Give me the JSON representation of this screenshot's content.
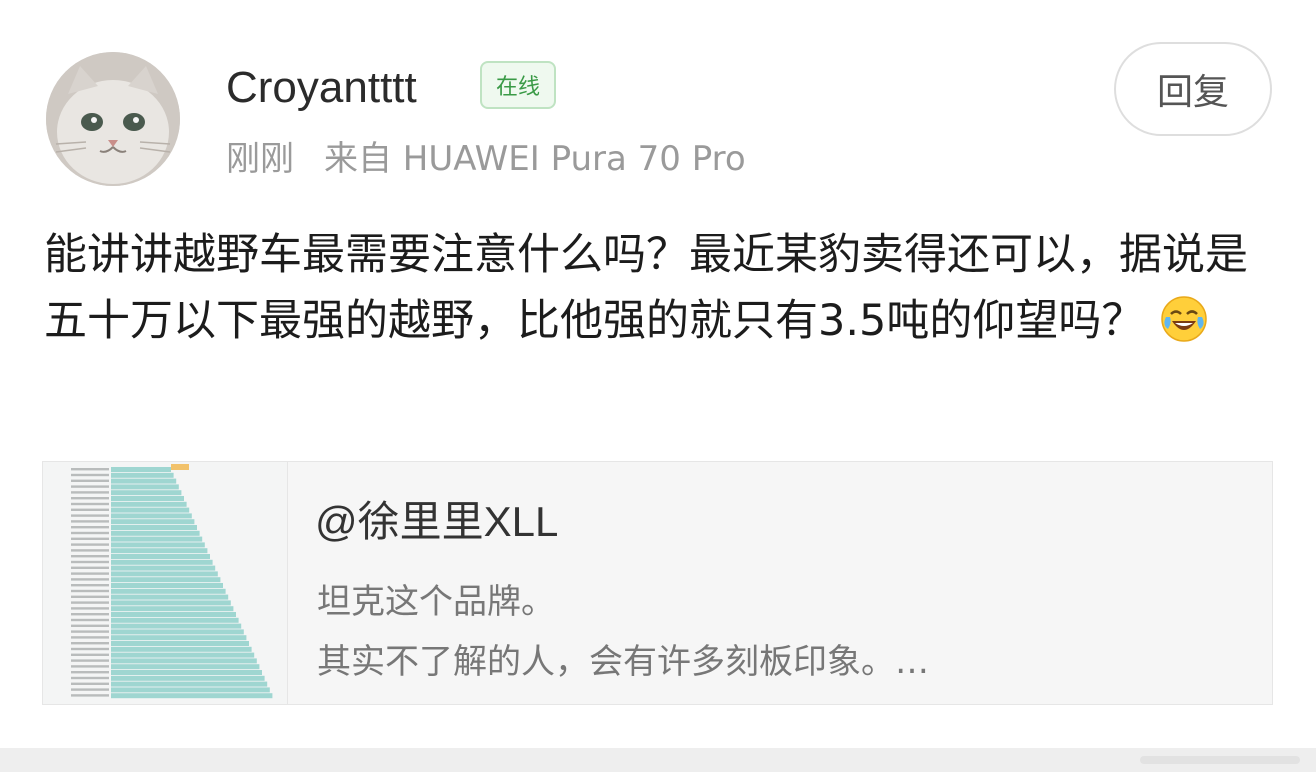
{
  "user": {
    "name": "Croyantttt",
    "status_badge": "在线",
    "time": "刚刚",
    "source": "来自 HUAWEI Pura 70 Pro"
  },
  "actions": {
    "reply_label": "回复"
  },
  "post": {
    "text": "能讲讲越野车最需要注意什么吗？最近某豹卖得还可以，据说是五十万以下最强的越野，比他强的就只有3.5吨的仰望吗？",
    "emoji": "laughing-crying-emoji"
  },
  "quote": {
    "author": "@徐里里XLL",
    "line1": "坦克这个品牌。",
    "line2": "其实不了解的人，会有许多刻板印象。…"
  },
  "colors": {
    "online_badge_text": "#3a9a46",
    "online_badge_bg": "#eff9ef",
    "meta_text": "#9a9a9a",
    "quote_bg": "#f6f6f6",
    "thumb_bar": "#9fd6d1"
  }
}
